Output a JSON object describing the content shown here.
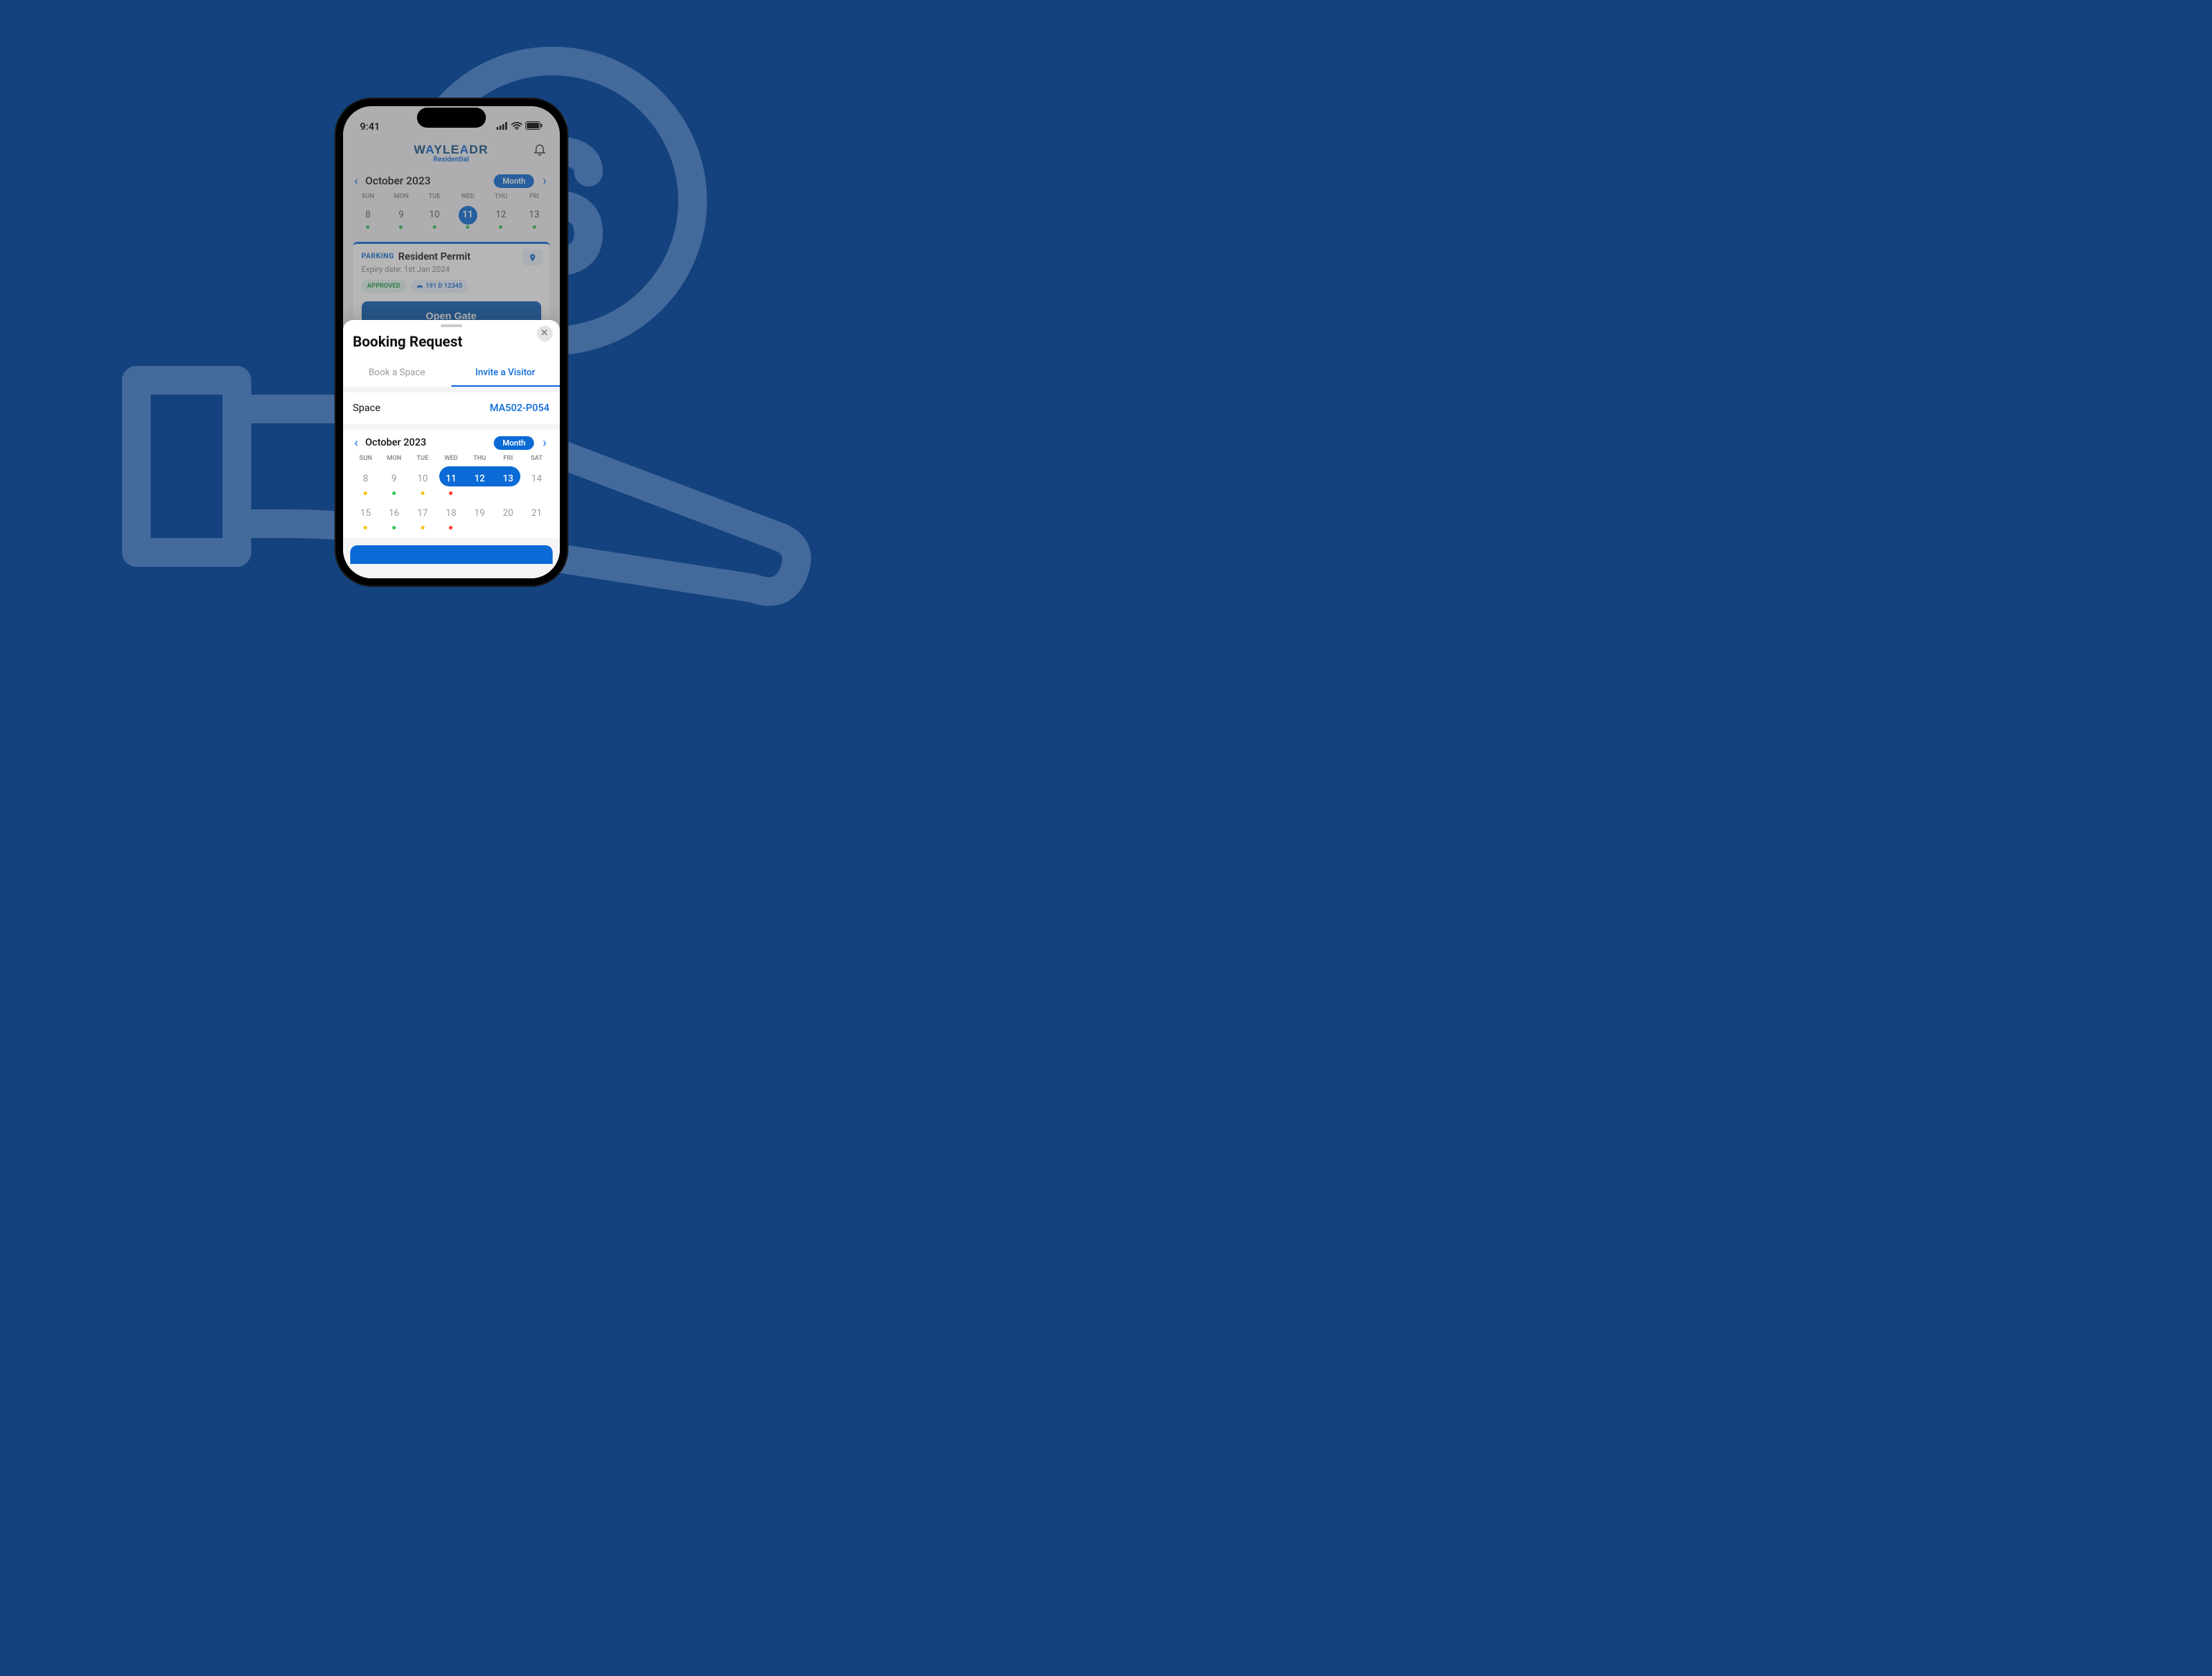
{
  "status_bar": {
    "time": "9:41"
  },
  "brand": {
    "line1_pre": "W",
    "line1_a": "A",
    "line1_mid": "YLE",
    "line1_a2": "A",
    "line1_post": "DR",
    "line2": "Residential"
  },
  "top": {
    "month_label": "October 2023",
    "month_pill": "Month",
    "weekdays": [
      "SUN",
      "MON",
      "TUE",
      "WED",
      "THU",
      "FRI"
    ],
    "dates": [
      "8",
      "9",
      "10",
      "11",
      "12",
      "13"
    ],
    "active_index": 3
  },
  "permit": {
    "tag": "PARKING",
    "title": "Resident Permit",
    "expiry": "Expiry date: 1st Jan 2024",
    "approved": "APPROVED",
    "plate": "191 D 12345",
    "open_gate": "Open Gate"
  },
  "sheet": {
    "title": "Booking Request",
    "tabs": {
      "book": "Book a Space",
      "invite": "Invite a Visitor"
    },
    "space_label": "Space",
    "space_value": "MA502-P054",
    "month_label": "October 2023",
    "month_pill": "Month",
    "weekdays": [
      "SUN",
      "MON",
      "TUE",
      "WED",
      "THU",
      "FRI",
      "SAT"
    ],
    "row1": [
      "8",
      "9",
      "10",
      "11",
      "12",
      "13",
      "14"
    ],
    "row1_dots": [
      "yellow",
      "green",
      "yellow",
      "red",
      "",
      "",
      ""
    ],
    "row1_range": [
      3,
      5
    ],
    "row2": [
      "15",
      "16",
      "17",
      "18",
      "19",
      "20",
      "21"
    ],
    "row2_dots": [
      "yellow",
      "green",
      "yellow",
      "red",
      "",
      "",
      ""
    ]
  }
}
